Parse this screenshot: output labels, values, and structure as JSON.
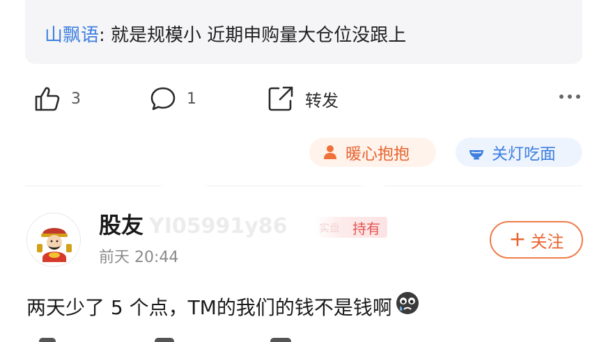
{
  "reply": {
    "user": "山飘语",
    "separator": ": ",
    "text": "就是规模小 近期申购量大仓位没跟上"
  },
  "actions": {
    "like_count": "3",
    "comment_count": "1",
    "share_label": "转发"
  },
  "reactions": {
    "warm_label": "暖心抱抱",
    "light_label": "关灯吃面"
  },
  "post": {
    "username": "股友",
    "user_id": "YI05991y86",
    "badge_faint": "实盘",
    "badge": "持有",
    "time": "前天 20:44",
    "follow_label": "关注",
    "follow_plus": "+",
    "content": "两天少了 5 个点，TM的我们的钱不是钱啊"
  },
  "colors": {
    "accent_orange": "#e8642f",
    "link_blue": "#3d7ee0",
    "badge_red": "#e25555"
  }
}
